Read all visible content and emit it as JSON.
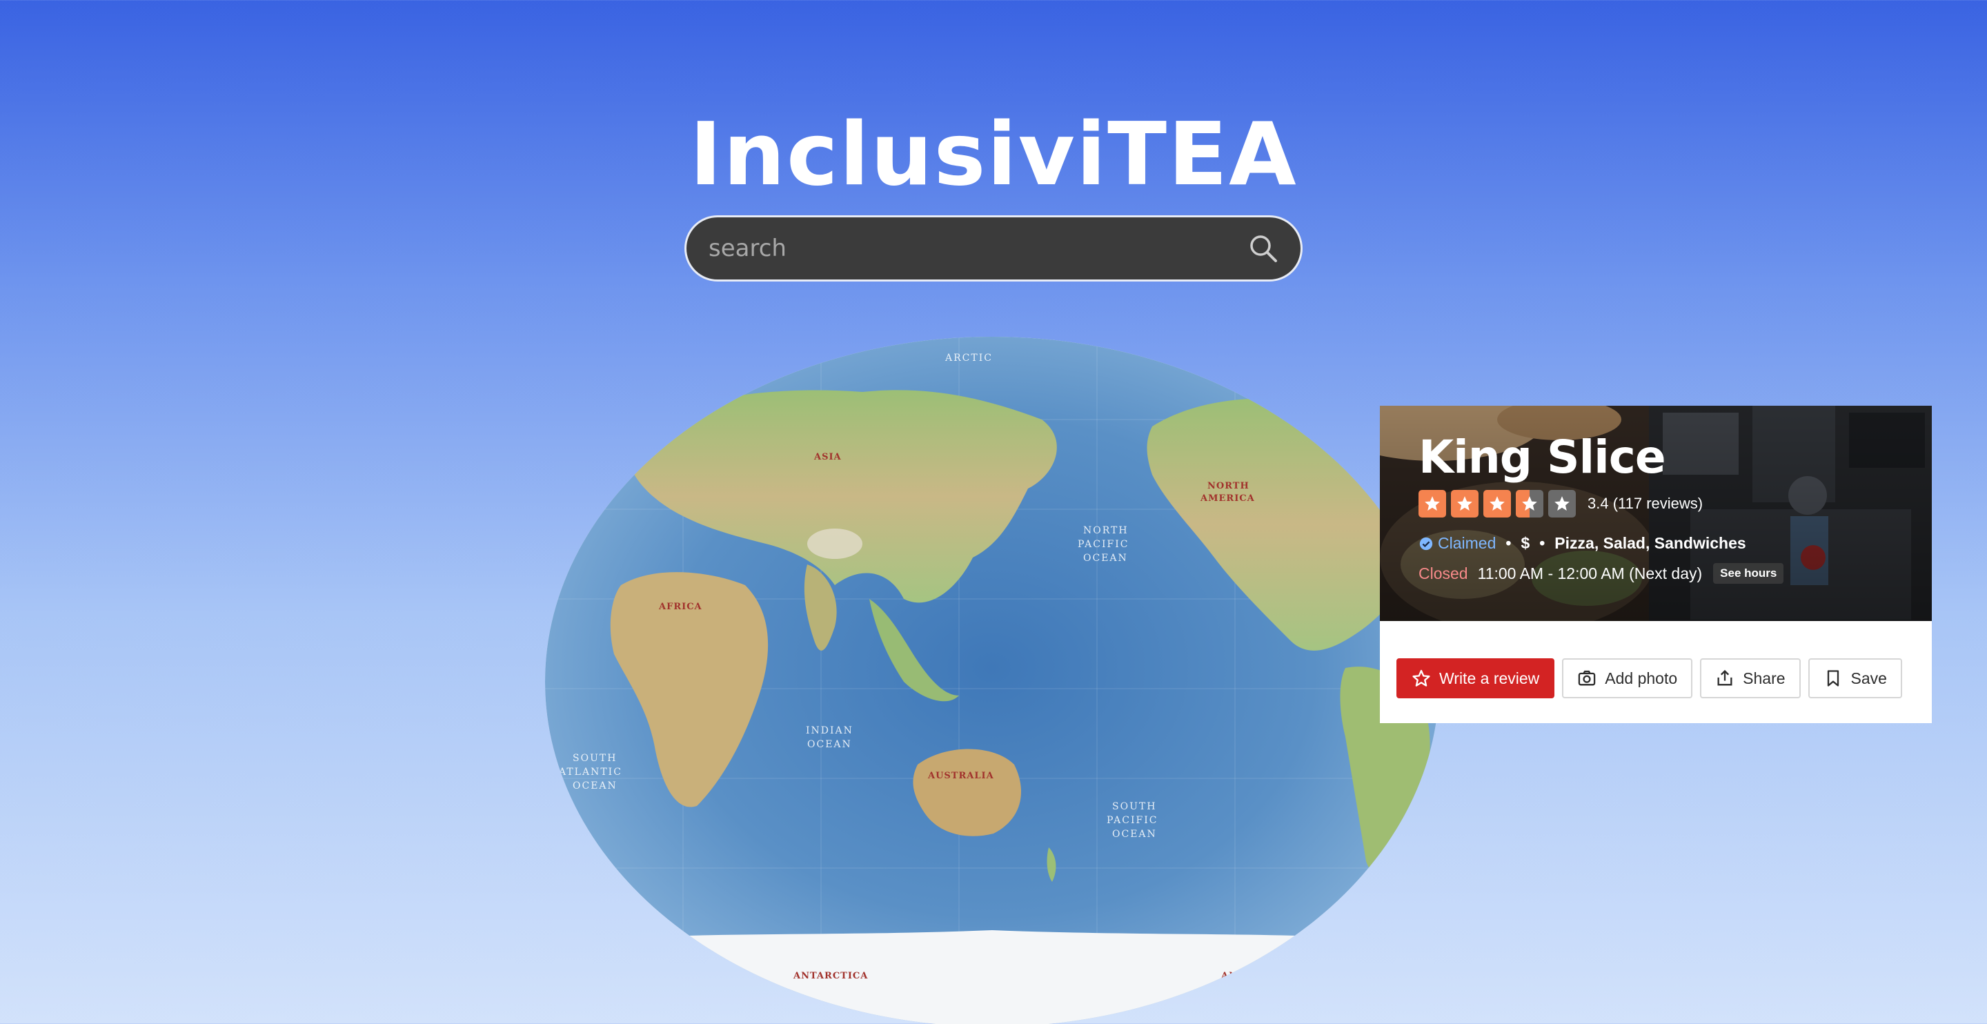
{
  "app": {
    "title": "InclusiviTEA"
  },
  "search": {
    "placeholder": "search",
    "icon": "search-icon"
  },
  "map": {
    "ocean_labels": [
      "NORTH",
      "PACIFIC",
      "OCEAN",
      "SOUTH",
      "PACIFIC",
      "OCEAN",
      "INDIAN",
      "OCEAN",
      "SOUTH",
      "ATLANTIC",
      "OCEAN"
    ],
    "continent_labels": [
      "ASIA",
      "AFRICA",
      "AUSTRALIA",
      "NORTH",
      "AMERICA",
      "ANTARCTICA",
      "ANTARCTICA"
    ],
    "arctic_label": "ARCTIC"
  },
  "business": {
    "name": "King Slice",
    "rating": 3.4,
    "stars_filled": 3.5,
    "rating_text": "3.4 (117 reviews)",
    "claimed_label": "Claimed",
    "price": "$",
    "categories": "Pizza, Salad, Sandwiches",
    "status": "Closed",
    "hours": "11:00 AM - 12:00 AM (Next day)",
    "see_hours_label": "See hours"
  },
  "actions": {
    "write_review": "Write a review",
    "add_photo": "Add photo",
    "share": "Share",
    "save": "Save"
  },
  "colors": {
    "star": "#f5834f",
    "star_empty": "#6b6b6b",
    "primary_button": "#d32323",
    "claimed": "#7fb7ff",
    "closed": "#f88a8a"
  }
}
